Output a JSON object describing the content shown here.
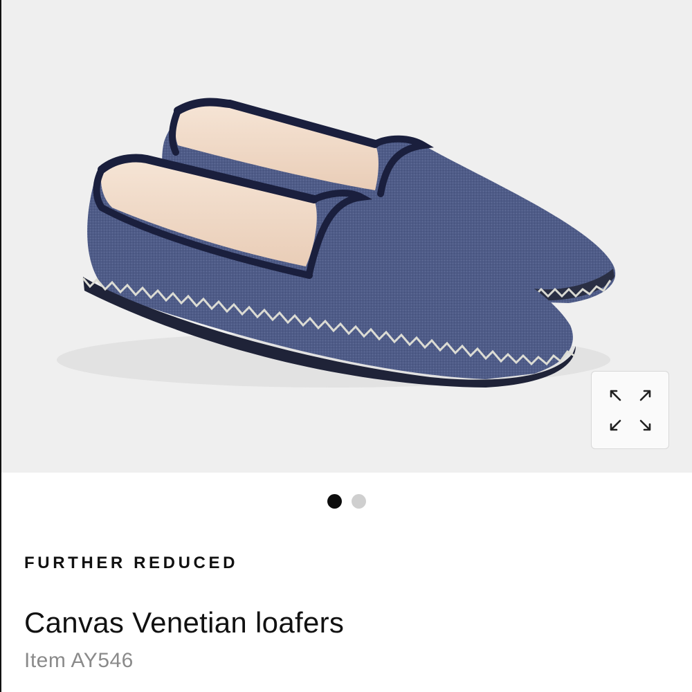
{
  "product": {
    "image_alt": "Canvas Venetian loafers",
    "badge": "FURTHER REDUCED",
    "title": "Canvas Venetian loafers",
    "item_number": "Item AY546"
  },
  "gallery": {
    "active_index": 0,
    "total": 2,
    "expand_icon": "expand-arrows-icon"
  },
  "colors": {
    "background": "#efefef",
    "shoe_fabric": "#4d5a85",
    "trim": "#1a1f3d",
    "lining": "#f1dccb",
    "stitch": "#d9d9d2"
  }
}
